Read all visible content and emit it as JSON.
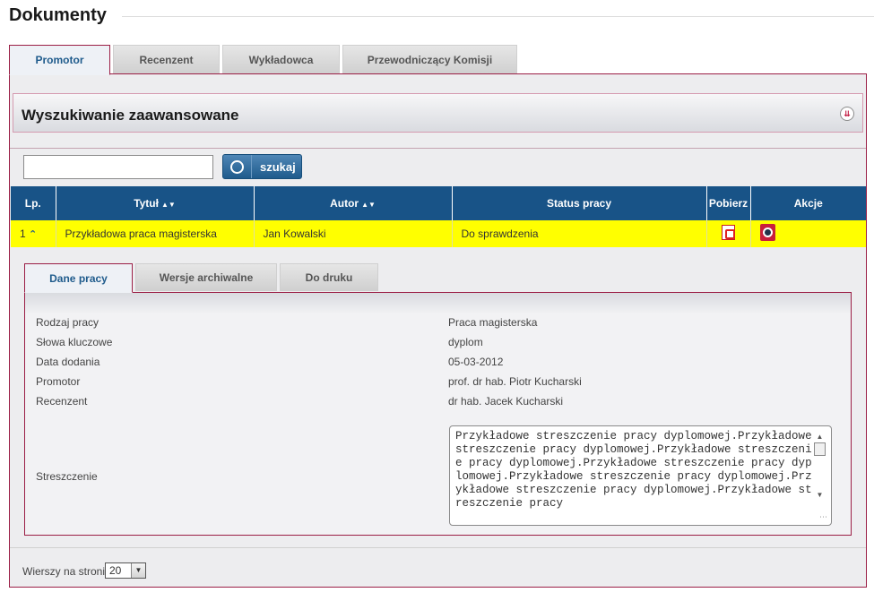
{
  "page": {
    "title": "Dokumenty"
  },
  "main_tabs": [
    {
      "label": "Promotor",
      "active": true
    },
    {
      "label": "Recenzent",
      "active": false
    },
    {
      "label": "Wykładowca",
      "active": false
    },
    {
      "label": "Przewodniczący Komisji",
      "active": false
    }
  ],
  "advanced_search": {
    "title": "Wyszukiwanie zaawansowane",
    "toggle_icon": "double-chevron-down-icon"
  },
  "search": {
    "value": "",
    "placeholder": "",
    "button_label": "szukaj"
  },
  "table": {
    "headers": {
      "lp": "Lp.",
      "title": "Tytuł",
      "author": "Autor",
      "status": "Status pracy",
      "download": "Pobierz",
      "actions": "Akcje"
    },
    "rows": [
      {
        "lp": "1",
        "title": "Przykładowa praca magisterska",
        "author": "Jan Kowalski",
        "status": "Do sprawdzenia",
        "download_icon": "pdf-icon",
        "action_icon": "view-details-icon"
      }
    ]
  },
  "detail_tabs": [
    {
      "label": "Dane pracy",
      "active": true
    },
    {
      "label": "Wersje archiwalne",
      "active": false
    },
    {
      "label": "Do druku",
      "active": false
    }
  ],
  "details": {
    "type_label": "Rodzaj pracy",
    "type_value": "Praca magisterska",
    "keywords_label": "Słowa kluczowe",
    "keywords_value": "dyplom",
    "date_label": "Data dodania",
    "date_value": "05-03-2012",
    "supervisor_label": "Promotor",
    "supervisor_value": "prof. dr hab. Piotr Kucharski",
    "reviewer_label": "Recenzent",
    "reviewer_value": "dr hab. Jacek Kucharski",
    "abstract_label": "Streszczenie",
    "abstract_value": "Przykładowe streszczenie pracy dyplomowej.Przykładowe streszczenie pracy dyplomowej.Przykładowe streszczenie pracy dyplomowej.Przykładowe streszczenie pracy dyplomowej.Przykładowe streszczenie pracy dyplomowej.Przykładowe streszczenie pracy dyplomowej.Przykładowe streszczenie pracy"
  },
  "pagination": {
    "rows_label": "Wierszy na stronie",
    "rows_value": "20"
  },
  "colors": {
    "accent": "#9b1e45",
    "header_blue": "#185387",
    "highlight": "#ffff00"
  }
}
